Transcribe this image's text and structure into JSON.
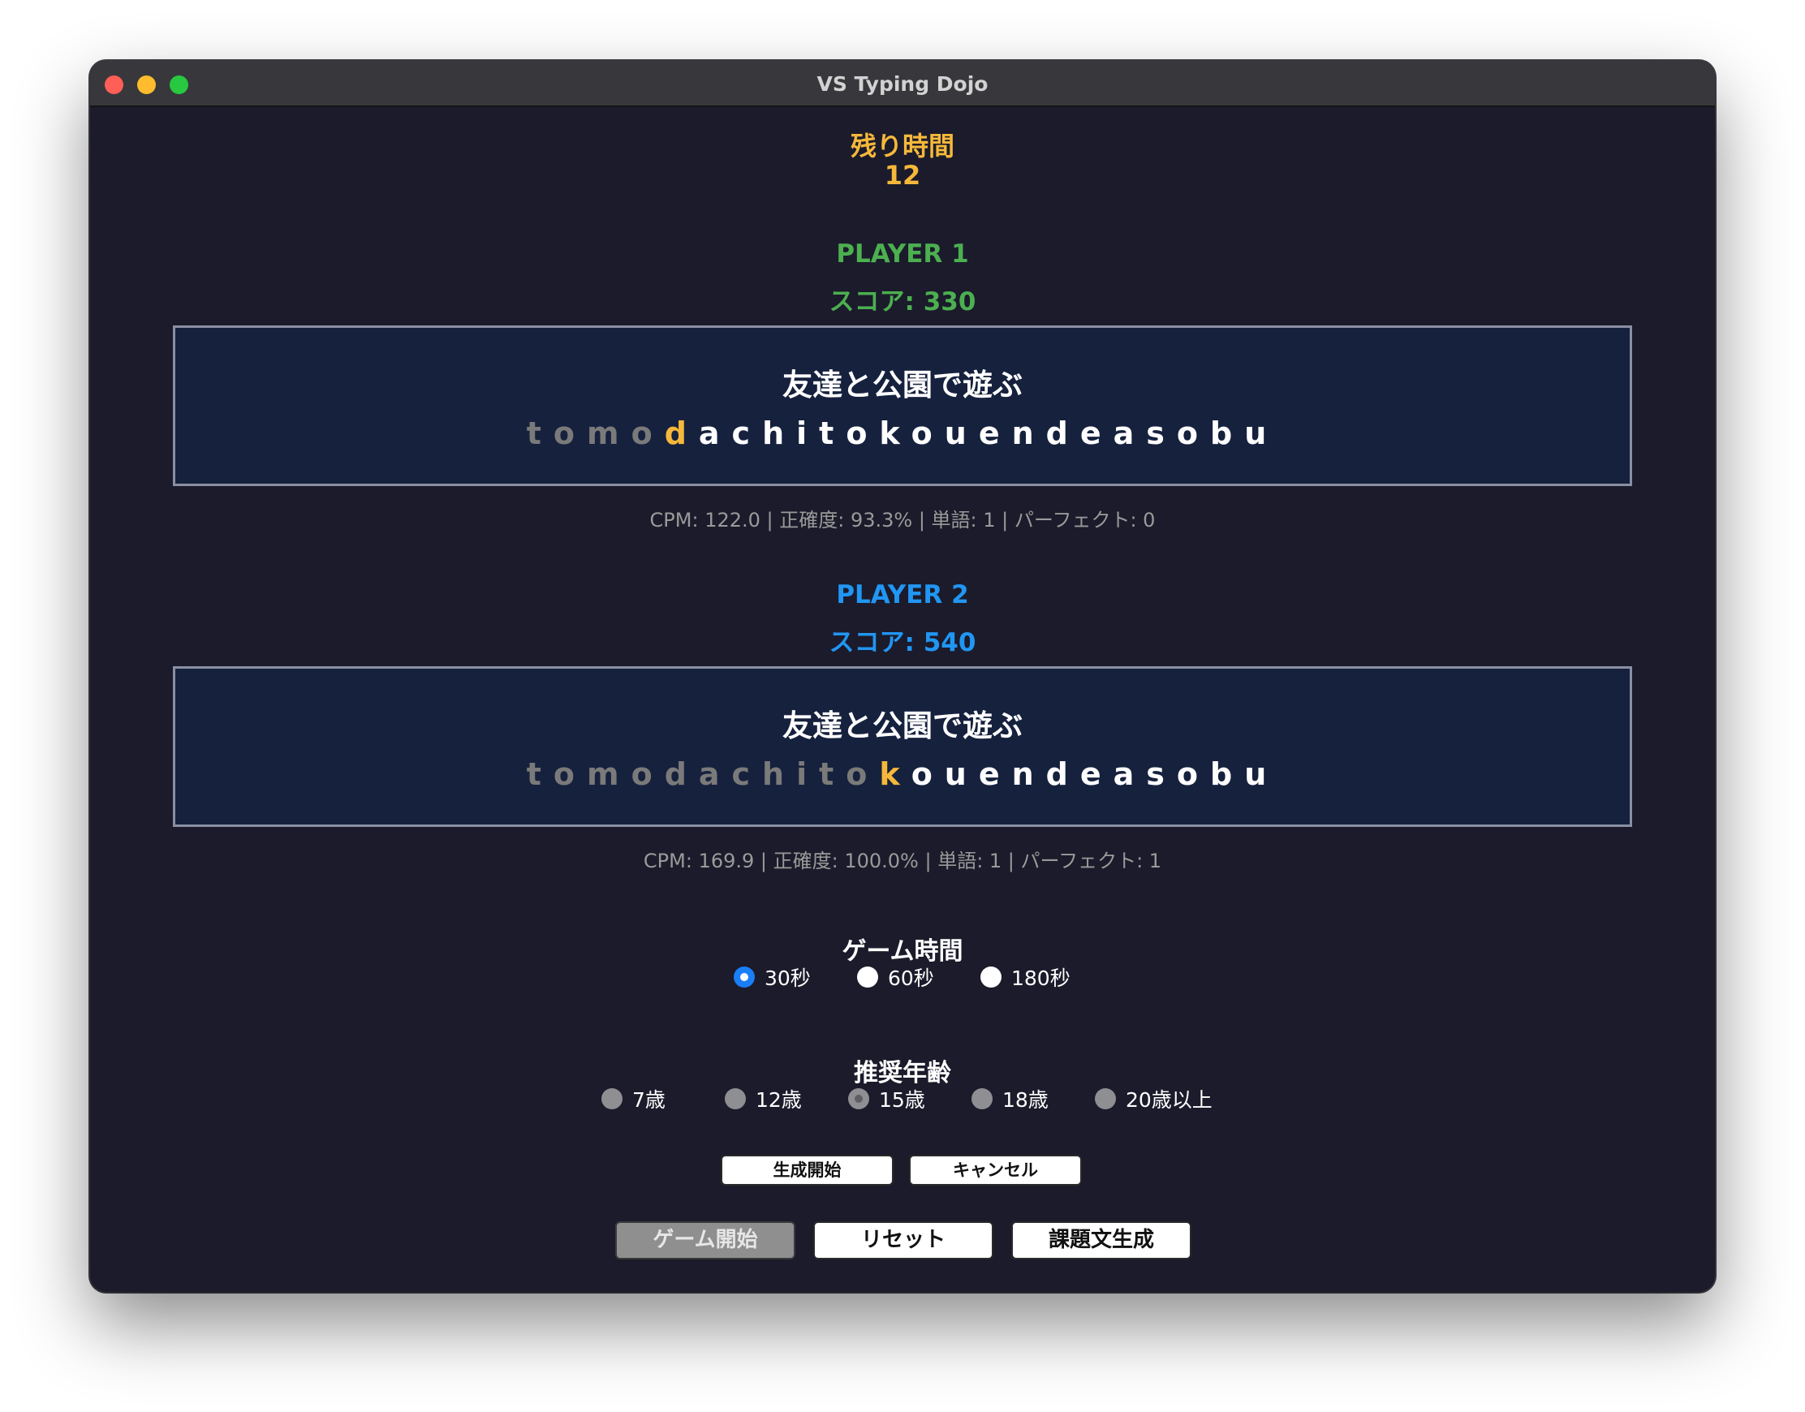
{
  "window": {
    "title": "VS Typing Dojo"
  },
  "timer": {
    "label": "残り時間",
    "value": "12"
  },
  "player1": {
    "name": "PLAYER 1",
    "score": "スコア: 330",
    "sentence": "友達と公園で遊ぶ",
    "romaji_typed": "tomo",
    "romaji_current": "d",
    "romaji_rest": "achitokouendeasobu",
    "stats": "CPM: 122.0 | 正確度: 93.3% | 単語: 1 | パーフェクト: 0",
    "color": "#4caf50"
  },
  "player2": {
    "name": "PLAYER 2",
    "score": "スコア: 540",
    "sentence": "友達と公園で遊ぶ",
    "romaji_typed": "tomodachito",
    "romaji_current": "k",
    "romaji_rest": "ouendeasobu",
    "stats": "CPM: 169.9 | 正確度: 100.0% | 単語: 1 | パーフェクト: 1",
    "color": "#2196f3"
  },
  "game_time": {
    "title": "ゲーム時間",
    "options": [
      "30秒",
      "60秒",
      "180秒"
    ],
    "selected": "30秒"
  },
  "age": {
    "title": "推奨年齢",
    "options": [
      "7歳",
      "12歳",
      "15歳",
      "18歳",
      "20歳以上"
    ],
    "selected": "15歳"
  },
  "generation": {
    "start_label": "生成開始",
    "cancel_label": "キャンセル"
  },
  "controls": {
    "start_label": "ゲーム開始",
    "reset_label": "リセット",
    "generate_label": "課題文生成"
  },
  "colors": {
    "timer": "#f6b83a",
    "current_char": "#f6b83a",
    "panel_bg": "#16213e",
    "window_bg": "#1b1b2b"
  }
}
